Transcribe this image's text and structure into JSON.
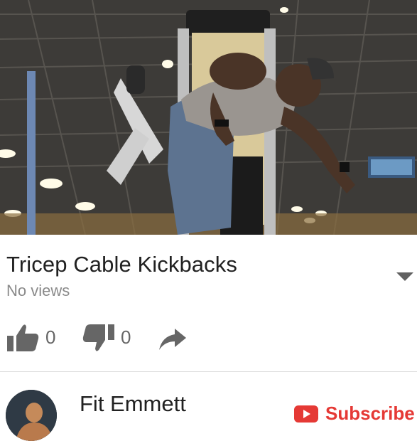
{
  "video": {
    "thumbnail_icon": "video-frame-gym-cable-machine"
  },
  "info": {
    "title": "Tricep Cable Kickbacks",
    "views": "No views",
    "expand_icon": "chevron-down-icon"
  },
  "actions": {
    "like_icon": "thumbs-up-icon",
    "like_count": "0",
    "dislike_icon": "thumbs-down-icon",
    "dislike_count": "0",
    "share_icon": "share-arrow-icon"
  },
  "channel": {
    "name": "Fit Emmett",
    "subscribe_label": "Subscribe",
    "subscribe_icon": "youtube-play-icon"
  },
  "colors": {
    "accent": "#e53935",
    "text_primary": "#212121",
    "text_secondary": "#8a8a8a",
    "icon_grey": "#666666"
  }
}
